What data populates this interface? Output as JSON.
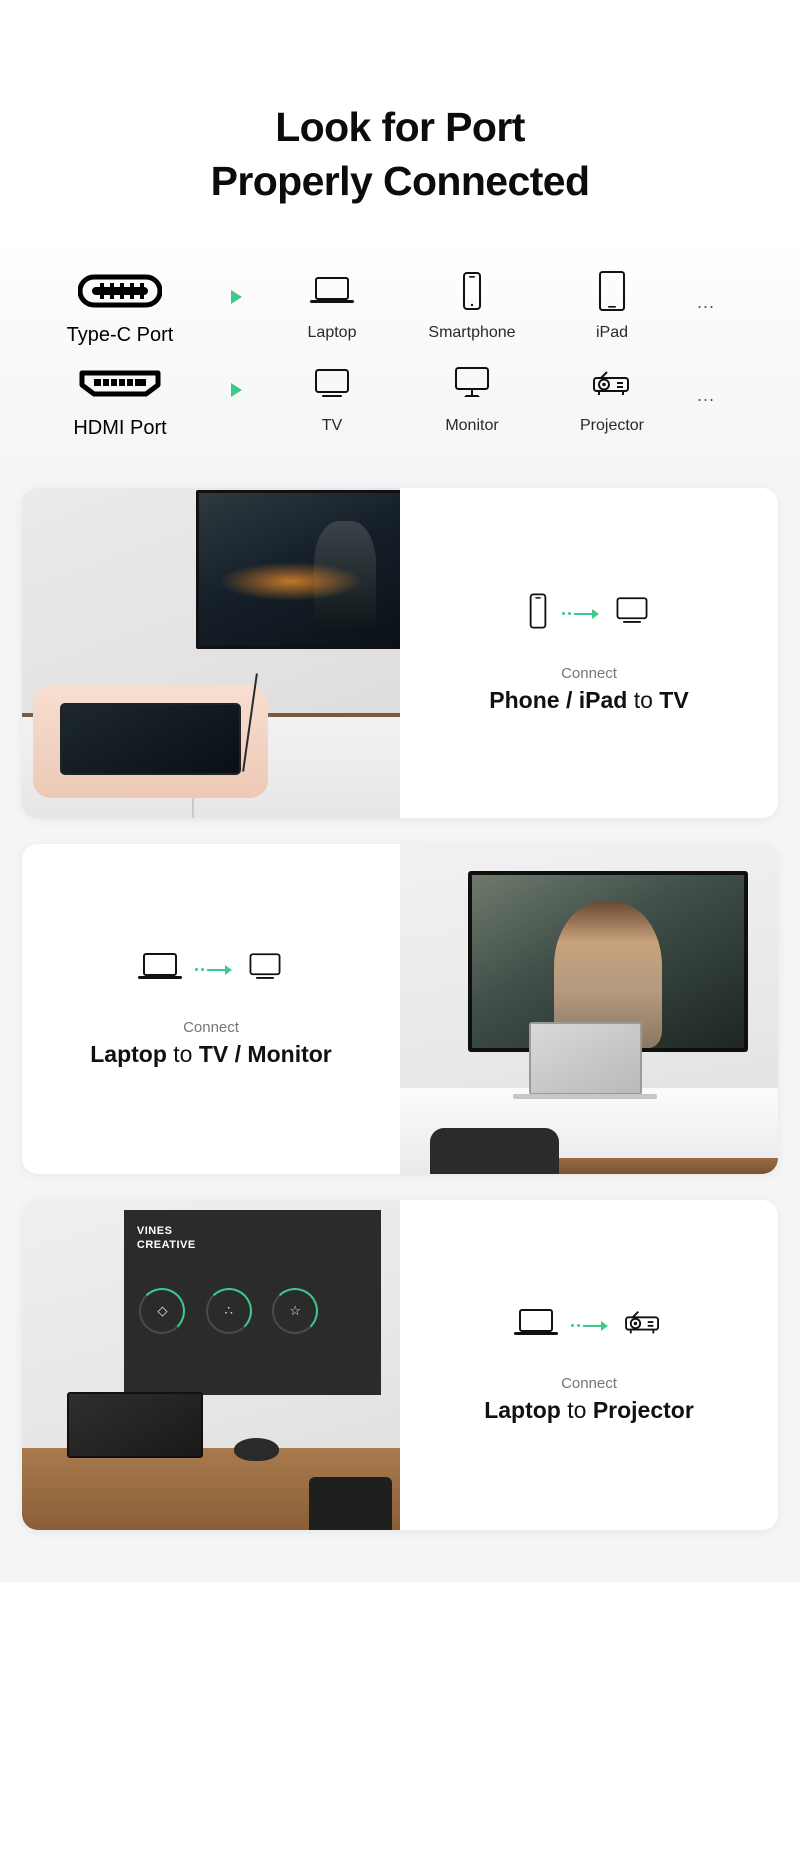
{
  "header": {
    "title_line1": "Look for Port",
    "title_line2": "Properly Connected"
  },
  "colors": {
    "accent_green": "#3ec98a",
    "text_dark": "#111111",
    "text_muted": "#767676",
    "panel_bg": "#f4f5f6"
  },
  "port_matrix": {
    "rows": [
      {
        "source_label": "Type-C Port",
        "source_icon": "usb-c-port-icon",
        "arrow_icon": "green-triangle-arrow-icon",
        "destinations": [
          {
            "label": "Laptop",
            "icon": "laptop-icon"
          },
          {
            "label": "Smartphone",
            "icon": "smartphone-icon"
          },
          {
            "label": "iPad",
            "icon": "tablet-icon"
          }
        ],
        "more": "..."
      },
      {
        "source_label": "HDMI Port",
        "source_icon": "hdmi-port-icon",
        "arrow_icon": "green-triangle-arrow-icon",
        "destinations": [
          {
            "label": "TV",
            "icon": "tv-icon"
          },
          {
            "label": "Monitor",
            "icon": "monitor-icon"
          },
          {
            "label": "Projector",
            "icon": "projector-icon"
          }
        ],
        "more": "..."
      }
    ]
  },
  "cards": [
    {
      "connect_label": "Connect",
      "caption_bold": "Phone / iPad",
      "caption_light": " to ",
      "caption_bold2": "TV",
      "from_icon": "smartphone-icon",
      "to_icon": "tv-icon",
      "photo_alt": "Hands holding a smartphone streaming a game to a wall-mounted TV"
    },
    {
      "connect_label": "Connect",
      "caption_bold": "Laptop",
      "caption_light": " to ",
      "caption_bold2": "TV / Monitor",
      "from_icon": "laptop-icon",
      "to_icon": "monitor-icon",
      "photo_alt": "Laptop on a desk mirroring a video call to a large monitor"
    },
    {
      "connect_label": "Connect",
      "caption_bold": "Laptop",
      "caption_light": " to ",
      "caption_bold2": "Projector",
      "from_icon": "laptop-icon",
      "to_icon": "projector-icon",
      "photo_alt": "Laptop on a wooden desk projecting a presentation slide onto a screen"
    }
  ],
  "scene3": {
    "board_title_line1": "VINES",
    "board_title_line2": "CREATIVE",
    "rings": [
      "◇",
      "∴",
      "☆"
    ]
  }
}
